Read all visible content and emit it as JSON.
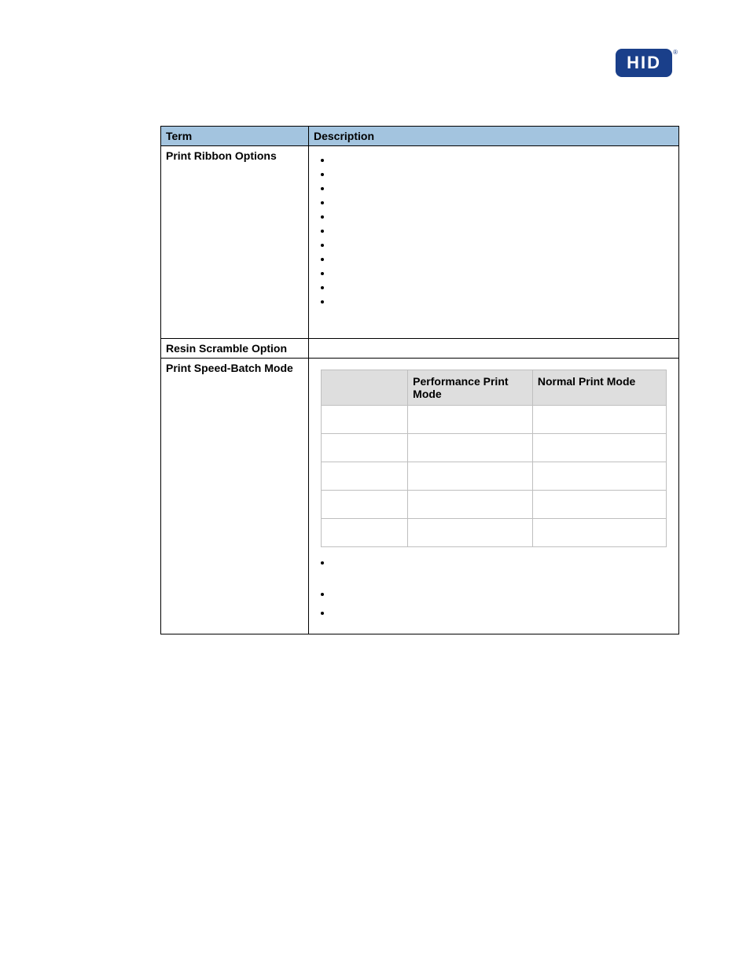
{
  "logo": {
    "text": "HID",
    "reg": "®"
  },
  "table": {
    "headers": {
      "term": "Term",
      "description": "Description"
    },
    "rows": {
      "ribbon": {
        "term": "Print Ribbon Options",
        "bullets": [
          "",
          "",
          "",
          "",
          "",
          "",
          "",
          "",
          "",
          "",
          ""
        ]
      },
      "resin": {
        "term": "Resin Scramble Option",
        "description": ""
      },
      "speed": {
        "term": "Print Speed-Batch Mode",
        "inner_headers": {
          "c1": "",
          "c2": "Performance Print Mode",
          "c3": "Normal Print Mode"
        },
        "inner_rows": [
          {
            "c1": "",
            "c2": "",
            "c3": ""
          },
          {
            "c1": "",
            "c2": "",
            "c3": ""
          },
          {
            "c1": "",
            "c2": "",
            "c3": ""
          },
          {
            "c1": "",
            "c2": "",
            "c3": ""
          },
          {
            "c1": "",
            "c2": "",
            "c3": ""
          }
        ],
        "notes": [
          "",
          "",
          ""
        ]
      }
    }
  }
}
